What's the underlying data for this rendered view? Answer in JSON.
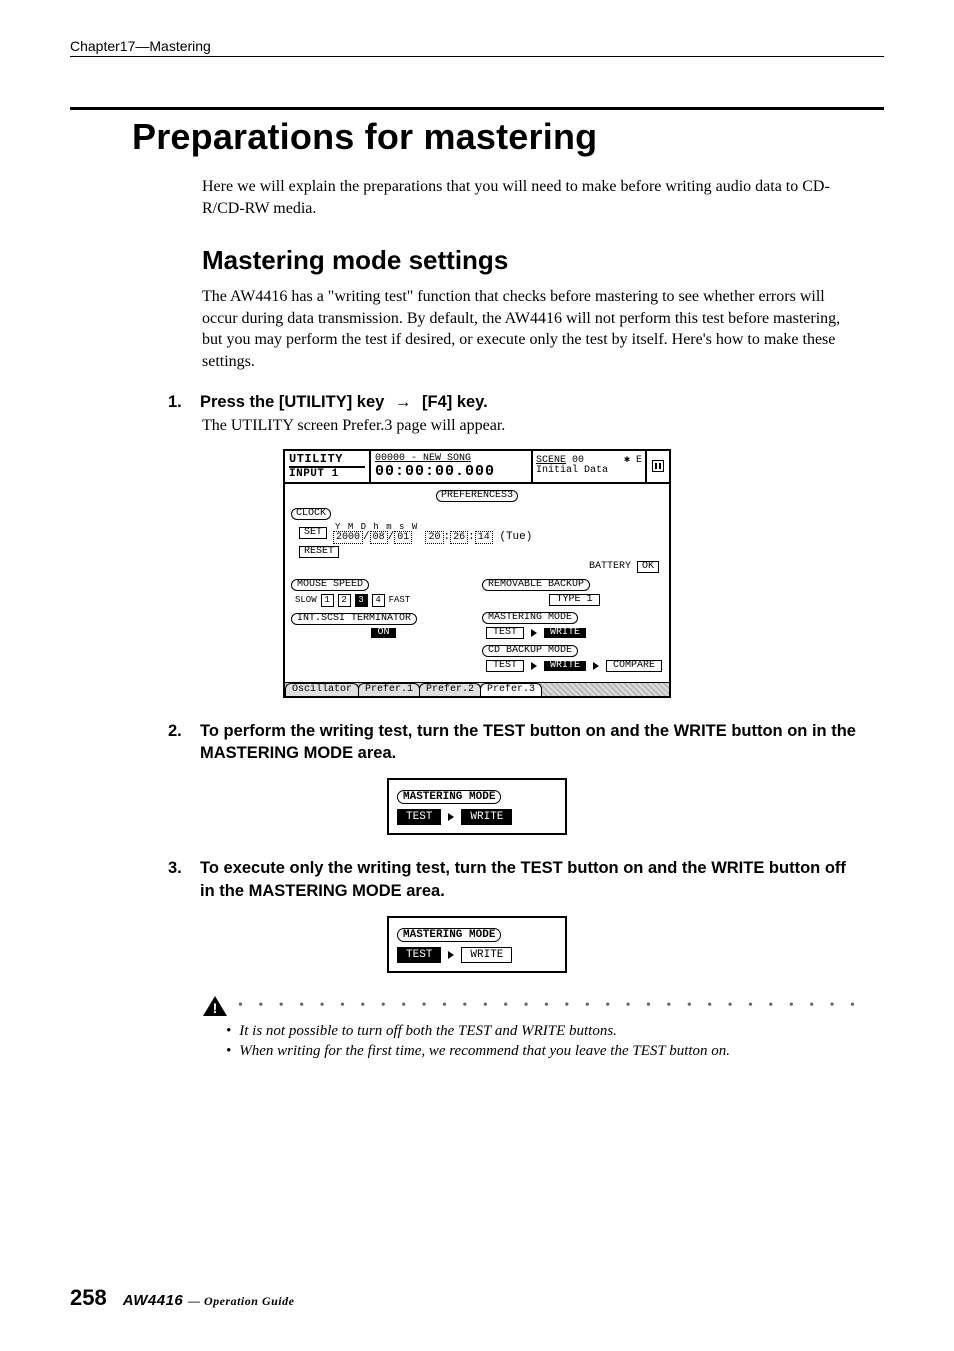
{
  "running_head": "Chapter17—Mastering",
  "title": "Preparations for mastering",
  "intro": "Here we will explain the preparations that you will need to make before writing audio data to CD-R/CD-RW media.",
  "section_title": "Mastering mode settings",
  "section_body": "The AW4416 has a \"writing test\" function that checks before mastering to see whether errors will occur during data transmission. By default, the AW4416 will not perform this test before mastering, but you may perform the test if desired, or execute only the test by itself. Here's how to make these settings.",
  "steps": {
    "s1": {
      "num": "1.",
      "text_a": "Press the [UTILITY] key",
      "arrow": "→",
      "text_b": "[F4] key.",
      "sub": "The UTILITY screen Prefer.3 page will appear."
    },
    "s2": {
      "num": "2.",
      "text": "To perform the writing test, turn the TEST button on and the WRITE button on in the MASTERING MODE area."
    },
    "s3": {
      "num": "3.",
      "text": "To execute only the writing test, turn the TEST button on and the WRITE button off in the MASTERING MODE area."
    }
  },
  "lcd": {
    "header": {
      "utility": "UTILITY",
      "input": "INPUT 1",
      "song": "00000 - NEW SONG",
      "counter": "00:00:00.000",
      "scene_label": "SCENE",
      "scene_num": "00",
      "e_marker": "E",
      "scene_name": "Initial Data"
    },
    "preferences_label": "PREFERENCES3",
    "clock": {
      "label": "CLOCK",
      "set": "SET",
      "reset": "RESET",
      "ymd_labels": "Y      M    D     h    m    s     W",
      "ymd_values_y": "2000",
      "ymd_values_m": "08",
      "ymd_values_d": "01",
      "ymd_values_h": "20",
      "ymd_values_mi": "26",
      "ymd_values_s": "14",
      "ymd_sep1": "/",
      "ymd_sep2": ":",
      "ymd_dow": "(Tue)",
      "battery_label": "BATTERY",
      "battery_val": "OK"
    },
    "mouse": {
      "label": "MOUSE SPEED",
      "slow": "SLOW",
      "fast": "FAST",
      "vals": [
        "1",
        "2",
        "3",
        "4"
      ]
    },
    "backup": {
      "label": "REMOVABLE BACKUP",
      "type": "TYPE 1"
    },
    "terminator": {
      "label": "INT.SCSI TERMINATOR",
      "val": "ON"
    },
    "mastering_mode": {
      "label": "MASTERING MODE",
      "test": "TEST",
      "write": "WRITE"
    },
    "cd_backup": {
      "label": "CD BACKUP MODE",
      "test": "TEST",
      "write": "WRITE",
      "compare": "COMPARE"
    },
    "tabs": [
      "Oscillator",
      "Prefer.1",
      "Prefer.2",
      "Prefer.3"
    ]
  },
  "mini2": {
    "label": "MASTERING MODE",
    "test": "TEST",
    "write": "WRITE"
  },
  "mini3": {
    "label": "MASTERING MODE",
    "test": "TEST",
    "write": "WRITE"
  },
  "warning": {
    "items": [
      "It is not possible to turn off both the TEST and WRITE buttons.",
      "When writing for the first time, we recommend that you leave the TEST button on."
    ]
  },
  "footer": {
    "page": "258",
    "product_prefix": "AW",
    "product_num": "4416",
    "guide_sep": "—",
    "guide": "Operation Guide"
  }
}
